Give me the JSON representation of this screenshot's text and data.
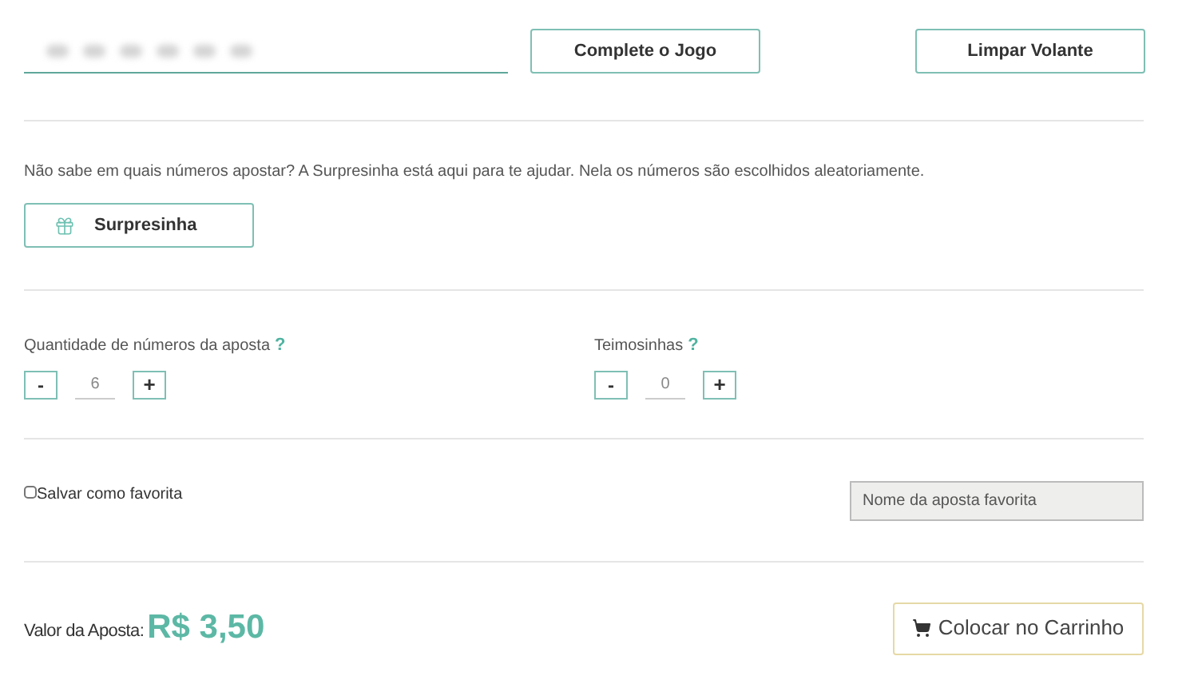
{
  "actions": [
    "Complete o Jogo",
    "Limpar Volante"
  ],
  "surprise": {
    "text": "Não sabe em quais números apostar? A Surpresinha está aqui para te ajudar. Nela os números são escolhidos aleatoriamente.",
    "button": "Surpresinha"
  },
  "steppers": [
    {
      "label": "Quantidade de números da aposta",
      "help": "?",
      "minus": "-",
      "value": "6",
      "plus": "+"
    },
    {
      "label": "Teimosinhas",
      "help": "?",
      "minus": "-",
      "value": "0",
      "plus": "+"
    }
  ],
  "favorite": {
    "label": "Salvar como favorita",
    "checked": false,
    "placeholder": "Nome da aposta favorita"
  },
  "total": {
    "label": "Valor da Aposta:",
    "value": "R$ 3,50"
  },
  "cart_button": "Colocar no Carrinho"
}
